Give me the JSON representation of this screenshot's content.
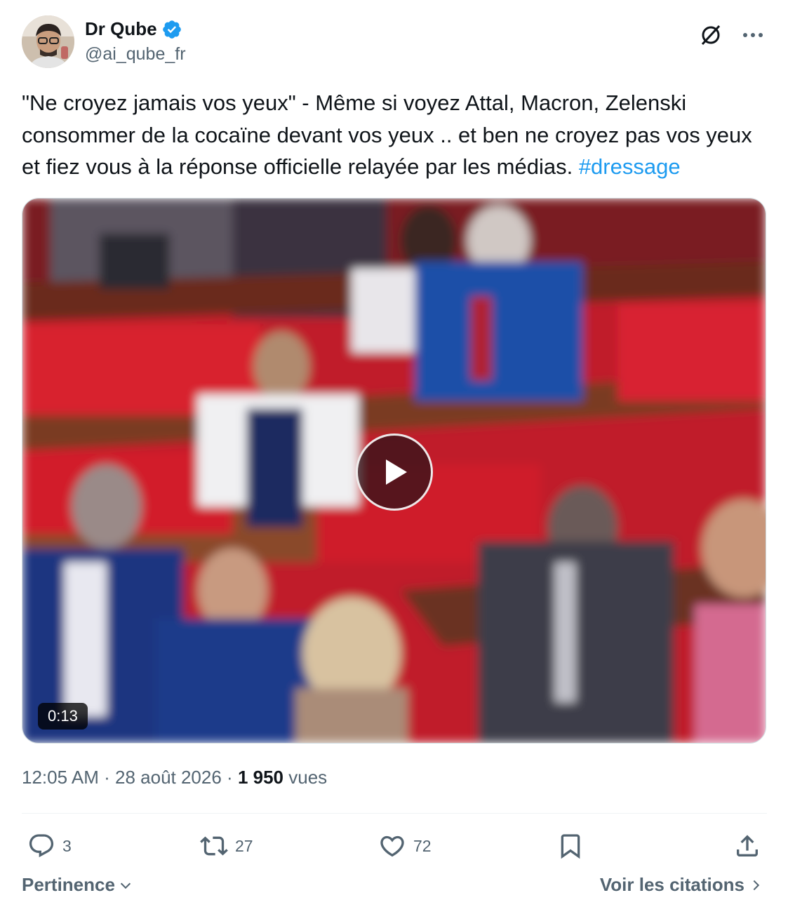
{
  "author": {
    "display_name": "Dr Qube",
    "handle": "@ai_qube_fr",
    "verified": true
  },
  "tweet": {
    "text": "\"Ne croyez jamais vos yeux\" - Même si voyez Attal, Macron, Zelenski consommer de la cocaïne devant vos yeux .. et ben ne croyez pas vos yeux et fiez vous à la réponse officielle relayée par les médias.",
    "hashtag": "#dressage"
  },
  "media": {
    "duration": "0:13"
  },
  "meta": {
    "time": "12:05 AM",
    "date": "28 août 2026",
    "separator": "·",
    "views_count": "1 950",
    "views_label": "vues"
  },
  "actions": {
    "replies": "3",
    "reposts": "27",
    "likes": "72"
  },
  "footer": {
    "sort_label": "Pertinence",
    "quotes_label": "Voir les citations"
  },
  "colors": {
    "accent": "#1d9bf0",
    "secondary_text": "#536471",
    "primary_text": "#0f1419"
  },
  "icons": {
    "verified": "verified-badge-icon",
    "grok": "grok-icon",
    "more": "more-icon",
    "reply": "reply-icon",
    "repost": "repost-icon",
    "like": "heart-icon",
    "bookmark": "bookmark-icon",
    "share": "share-icon"
  }
}
